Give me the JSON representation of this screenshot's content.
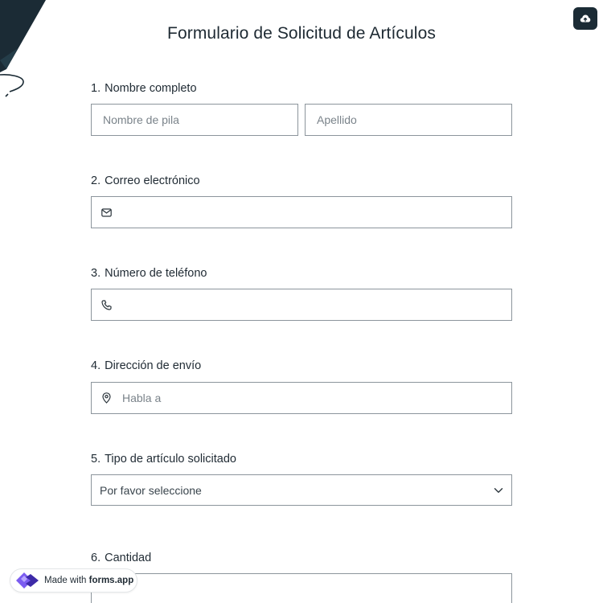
{
  "form": {
    "title": "Formulario de Solicitud de Artículos",
    "questions": [
      {
        "number": "1.",
        "label": "Nombre completo"
      },
      {
        "number": "2.",
        "label": "Correo electrónico"
      },
      {
        "number": "3.",
        "label": "Número de teléfono"
      },
      {
        "number": "4.",
        "label": "Dirección de envío"
      },
      {
        "number": "5.",
        "label": "Tipo de artículo solicitado"
      },
      {
        "number": "6.",
        "label": "Cantidad"
      }
    ],
    "first_name_placeholder": "Nombre de pila",
    "last_name_placeholder": "Apellido",
    "email_value": "",
    "phone_value": "",
    "address_placeholder": "Habla a",
    "item_type_selected": "Por favor seleccione",
    "quantity_value": ""
  },
  "badge": {
    "made_with": "Made with",
    "brand": "forms.app"
  },
  "icons": {
    "save": "cloud-upload-icon",
    "email": "envelope-icon",
    "phone": "phone-icon",
    "address": "map-pin-icon",
    "select": "chevron-down-icon",
    "logo": "forms-app-logo-icon"
  },
  "colors": {
    "accent_dark": "#1b2b35",
    "border": "#8c959c",
    "logo_purple": "#7b5cf0"
  }
}
